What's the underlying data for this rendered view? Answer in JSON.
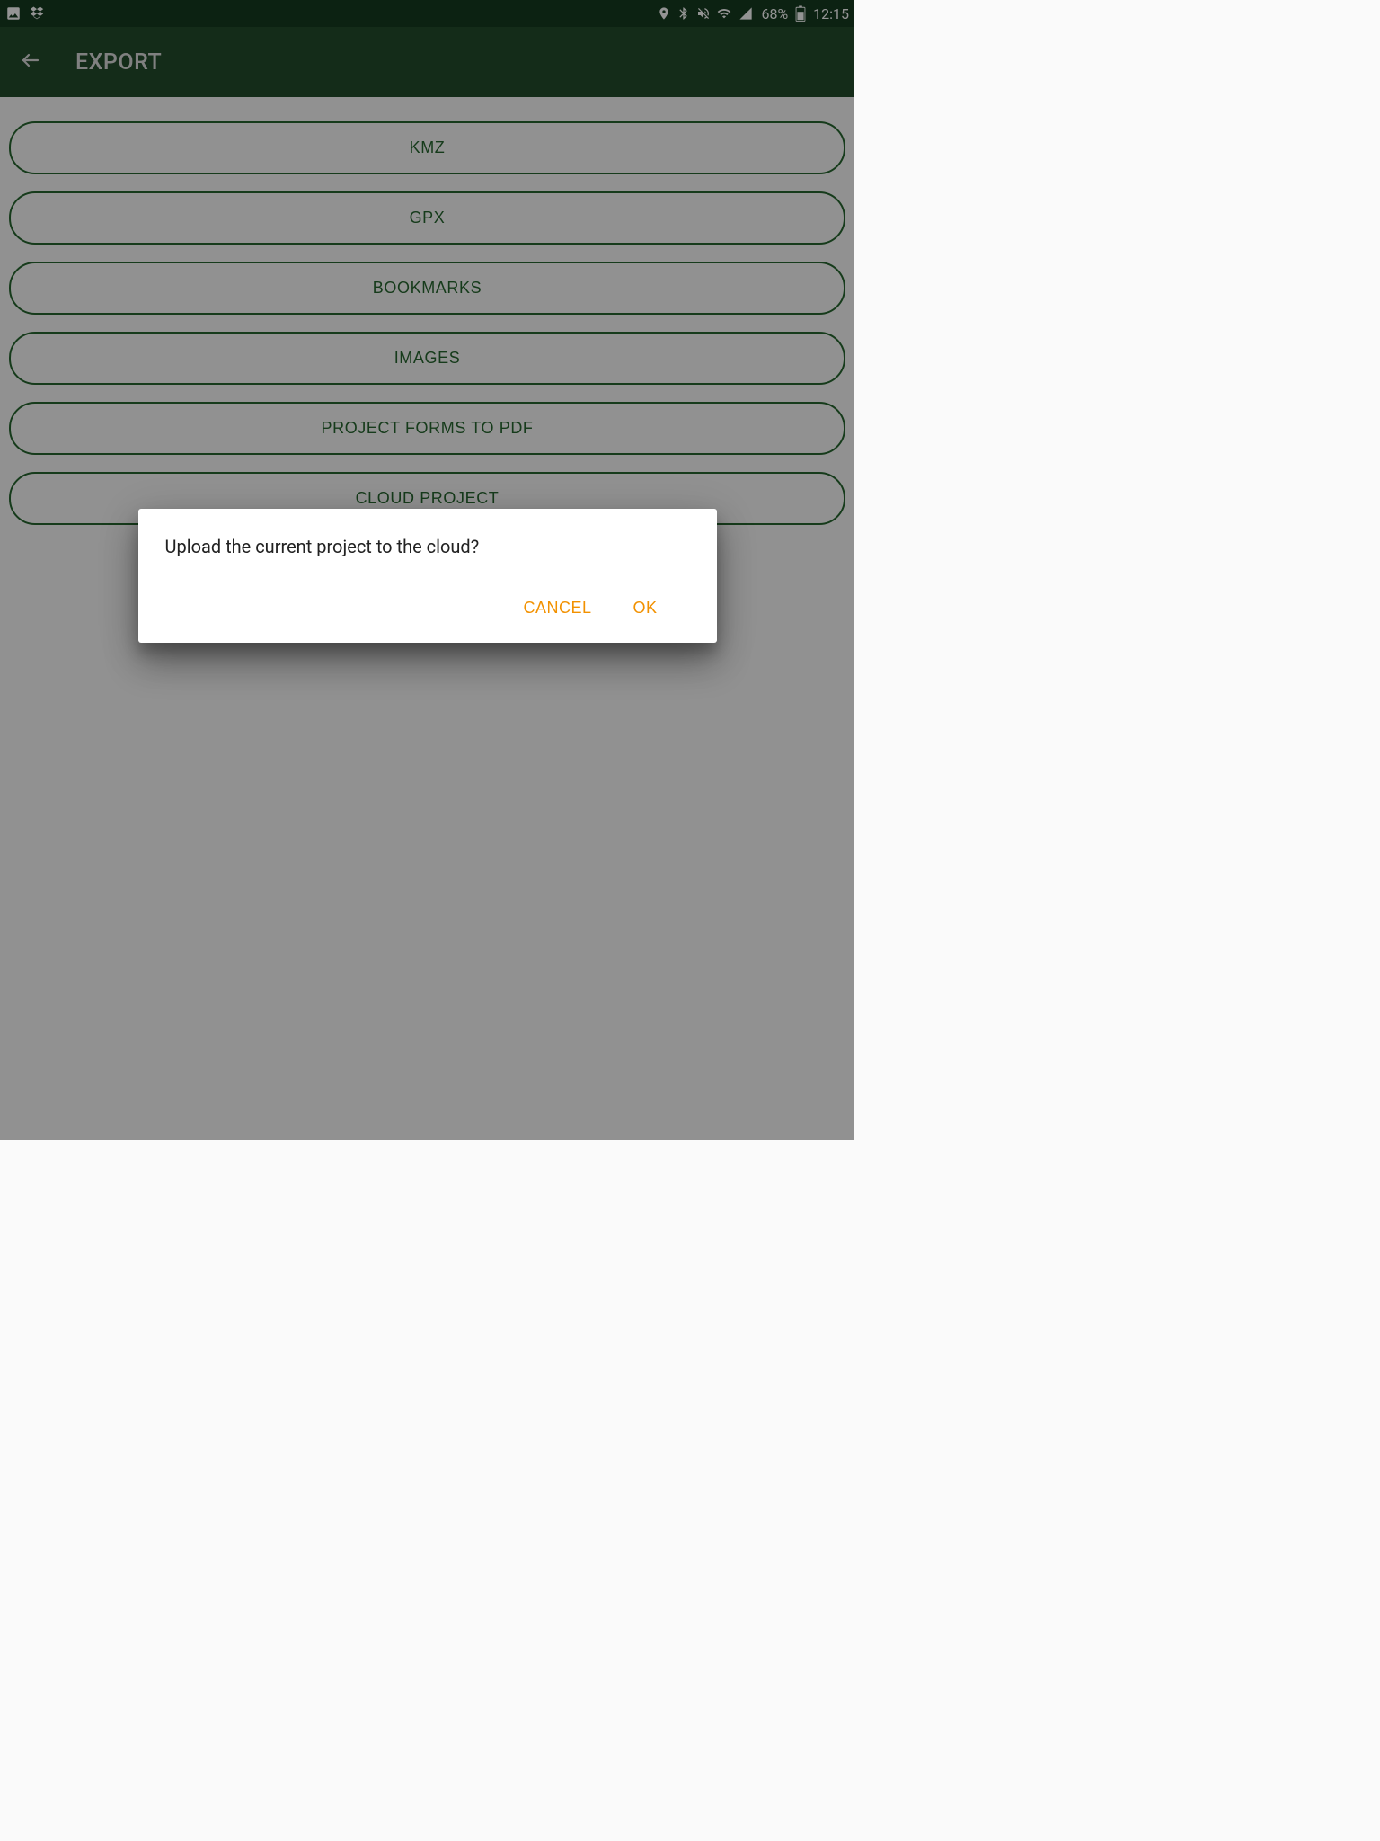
{
  "status": {
    "battery": "68%",
    "clock": "12:15"
  },
  "appbar": {
    "title": "EXPORT"
  },
  "export_options": [
    {
      "label": "KMZ"
    },
    {
      "label": "GPX"
    },
    {
      "label": "BOOKMARKS"
    },
    {
      "label": "IMAGES"
    },
    {
      "label": "PROJECT FORMS TO PDF"
    },
    {
      "label": "CLOUD PROJECT"
    }
  ],
  "dialog": {
    "message": "Upload the current project to the cloud?",
    "cancel": "CANCEL",
    "ok": "OK"
  }
}
